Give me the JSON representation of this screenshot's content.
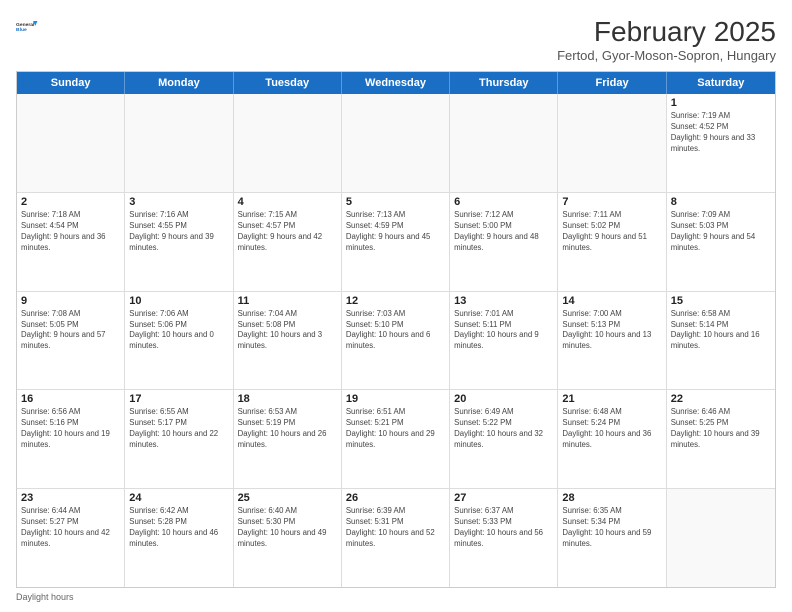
{
  "header": {
    "logo_general": "General",
    "logo_blue": "Blue",
    "title": "February 2025",
    "subtitle": "Fertod, Gyor-Moson-Sopron, Hungary"
  },
  "days_of_week": [
    "Sunday",
    "Monday",
    "Tuesday",
    "Wednesday",
    "Thursday",
    "Friday",
    "Saturday"
  ],
  "footer": {
    "daylight_label": "Daylight hours"
  },
  "weeks": [
    {
      "cells": [
        {
          "day": "",
          "empty": true
        },
        {
          "day": "",
          "empty": true
        },
        {
          "day": "",
          "empty": true
        },
        {
          "day": "",
          "empty": true
        },
        {
          "day": "",
          "empty": true
        },
        {
          "day": "",
          "empty": true
        },
        {
          "day": "1",
          "sunrise": "Sunrise: 7:19 AM",
          "sunset": "Sunset: 4:52 PM",
          "daylight": "Daylight: 9 hours and 33 minutes."
        }
      ]
    },
    {
      "cells": [
        {
          "day": "2",
          "sunrise": "Sunrise: 7:18 AM",
          "sunset": "Sunset: 4:54 PM",
          "daylight": "Daylight: 9 hours and 36 minutes."
        },
        {
          "day": "3",
          "sunrise": "Sunrise: 7:16 AM",
          "sunset": "Sunset: 4:55 PM",
          "daylight": "Daylight: 9 hours and 39 minutes."
        },
        {
          "day": "4",
          "sunrise": "Sunrise: 7:15 AM",
          "sunset": "Sunset: 4:57 PM",
          "daylight": "Daylight: 9 hours and 42 minutes."
        },
        {
          "day": "5",
          "sunrise": "Sunrise: 7:13 AM",
          "sunset": "Sunset: 4:59 PM",
          "daylight": "Daylight: 9 hours and 45 minutes."
        },
        {
          "day": "6",
          "sunrise": "Sunrise: 7:12 AM",
          "sunset": "Sunset: 5:00 PM",
          "daylight": "Daylight: 9 hours and 48 minutes."
        },
        {
          "day": "7",
          "sunrise": "Sunrise: 7:11 AM",
          "sunset": "Sunset: 5:02 PM",
          "daylight": "Daylight: 9 hours and 51 minutes."
        },
        {
          "day": "8",
          "sunrise": "Sunrise: 7:09 AM",
          "sunset": "Sunset: 5:03 PM",
          "daylight": "Daylight: 9 hours and 54 minutes."
        }
      ]
    },
    {
      "cells": [
        {
          "day": "9",
          "sunrise": "Sunrise: 7:08 AM",
          "sunset": "Sunset: 5:05 PM",
          "daylight": "Daylight: 9 hours and 57 minutes."
        },
        {
          "day": "10",
          "sunrise": "Sunrise: 7:06 AM",
          "sunset": "Sunset: 5:06 PM",
          "daylight": "Daylight: 10 hours and 0 minutes."
        },
        {
          "day": "11",
          "sunrise": "Sunrise: 7:04 AM",
          "sunset": "Sunset: 5:08 PM",
          "daylight": "Daylight: 10 hours and 3 minutes."
        },
        {
          "day": "12",
          "sunrise": "Sunrise: 7:03 AM",
          "sunset": "Sunset: 5:10 PM",
          "daylight": "Daylight: 10 hours and 6 minutes."
        },
        {
          "day": "13",
          "sunrise": "Sunrise: 7:01 AM",
          "sunset": "Sunset: 5:11 PM",
          "daylight": "Daylight: 10 hours and 9 minutes."
        },
        {
          "day": "14",
          "sunrise": "Sunrise: 7:00 AM",
          "sunset": "Sunset: 5:13 PM",
          "daylight": "Daylight: 10 hours and 13 minutes."
        },
        {
          "day": "15",
          "sunrise": "Sunrise: 6:58 AM",
          "sunset": "Sunset: 5:14 PM",
          "daylight": "Daylight: 10 hours and 16 minutes."
        }
      ]
    },
    {
      "cells": [
        {
          "day": "16",
          "sunrise": "Sunrise: 6:56 AM",
          "sunset": "Sunset: 5:16 PM",
          "daylight": "Daylight: 10 hours and 19 minutes."
        },
        {
          "day": "17",
          "sunrise": "Sunrise: 6:55 AM",
          "sunset": "Sunset: 5:17 PM",
          "daylight": "Daylight: 10 hours and 22 minutes."
        },
        {
          "day": "18",
          "sunrise": "Sunrise: 6:53 AM",
          "sunset": "Sunset: 5:19 PM",
          "daylight": "Daylight: 10 hours and 26 minutes."
        },
        {
          "day": "19",
          "sunrise": "Sunrise: 6:51 AM",
          "sunset": "Sunset: 5:21 PM",
          "daylight": "Daylight: 10 hours and 29 minutes."
        },
        {
          "day": "20",
          "sunrise": "Sunrise: 6:49 AM",
          "sunset": "Sunset: 5:22 PM",
          "daylight": "Daylight: 10 hours and 32 minutes."
        },
        {
          "day": "21",
          "sunrise": "Sunrise: 6:48 AM",
          "sunset": "Sunset: 5:24 PM",
          "daylight": "Daylight: 10 hours and 36 minutes."
        },
        {
          "day": "22",
          "sunrise": "Sunrise: 6:46 AM",
          "sunset": "Sunset: 5:25 PM",
          "daylight": "Daylight: 10 hours and 39 minutes."
        }
      ]
    },
    {
      "cells": [
        {
          "day": "23",
          "sunrise": "Sunrise: 6:44 AM",
          "sunset": "Sunset: 5:27 PM",
          "daylight": "Daylight: 10 hours and 42 minutes."
        },
        {
          "day": "24",
          "sunrise": "Sunrise: 6:42 AM",
          "sunset": "Sunset: 5:28 PM",
          "daylight": "Daylight: 10 hours and 46 minutes."
        },
        {
          "day": "25",
          "sunrise": "Sunrise: 6:40 AM",
          "sunset": "Sunset: 5:30 PM",
          "daylight": "Daylight: 10 hours and 49 minutes."
        },
        {
          "day": "26",
          "sunrise": "Sunrise: 6:39 AM",
          "sunset": "Sunset: 5:31 PM",
          "daylight": "Daylight: 10 hours and 52 minutes."
        },
        {
          "day": "27",
          "sunrise": "Sunrise: 6:37 AM",
          "sunset": "Sunset: 5:33 PM",
          "daylight": "Daylight: 10 hours and 56 minutes."
        },
        {
          "day": "28",
          "sunrise": "Sunrise: 6:35 AM",
          "sunset": "Sunset: 5:34 PM",
          "daylight": "Daylight: 10 hours and 59 minutes."
        },
        {
          "day": "",
          "empty": true
        }
      ]
    }
  ]
}
